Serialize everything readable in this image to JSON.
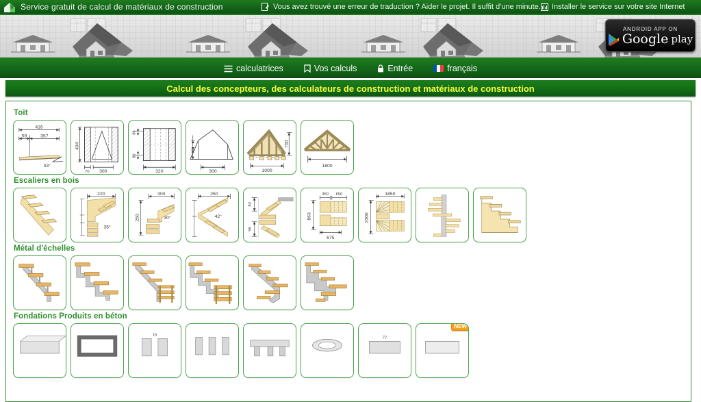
{
  "topbar": {
    "logo_icon": "house-leaf-logo-icon",
    "title": "Service gratuit de calcul de matériaux de construction",
    "links": [
      {
        "icon": "edit-note-icon",
        "label": "Vous avez trouvé une erreur de traduction ? Aider le projet. Il suffit d'une minute."
      },
      {
        "icon": "install-widget-icon",
        "label": "Installer le service sur votre site Internet"
      }
    ]
  },
  "banner": {
    "google_play": {
      "top_text": "ANDROID APP ON",
      "word1": "Google",
      "word2": "play",
      "icon": "google-play-triangle-icon"
    }
  },
  "nav": {
    "items": [
      {
        "icon": "hamburger-icon",
        "label": "calculatrices"
      },
      {
        "icon": "bookmark-icon",
        "label": "Vos calculs"
      },
      {
        "icon": "lock-icon",
        "label": "Entrée"
      },
      {
        "icon": "flag-france-icon",
        "label": "français"
      }
    ]
  },
  "page": {
    "title": "Calcul des concepteurs, des calculateurs de construction et matériaux de construction"
  },
  "sections": [
    {
      "title": "Toit",
      "tiles": [
        {
          "name": "roof-slope-calc",
          "labels": [
            "416",
            "59",
            "357",
            "33°"
          ]
        },
        {
          "name": "roof-gable-wall-calc",
          "labels": [
            "494",
            "70",
            "300"
          ]
        },
        {
          "name": "roof-wall-hatch-calc",
          "labels": [
            "86",
            "86",
            "320"
          ]
        },
        {
          "name": "roof-mansard-calc",
          "labels": [
            "300"
          ]
        },
        {
          "name": "roof-rafter-truss-calc",
          "labels": [
            "700",
            "1000"
          ]
        },
        {
          "name": "roof-truss-lattice-calc",
          "labels": [
            "1600"
          ]
        }
      ]
    },
    {
      "title": "Escaliers en bois",
      "tiles": [
        {
          "name": "wood-straight-stair-calc",
          "labels": []
        },
        {
          "name": "wood-stair-35deg-calc",
          "labels": [
            "220",
            "35°"
          ]
        },
        {
          "name": "wood-stair-30deg-calc",
          "labels": [
            "300",
            "250",
            "30°"
          ]
        },
        {
          "name": "wood-stair-zigzag-calc",
          "labels": [
            "250",
            "42°"
          ]
        },
        {
          "name": "wood-stair-landing-calc",
          "labels": [
            "83",
            "56"
          ]
        },
        {
          "name": "wood-stair-u-turn-calc",
          "labels": [
            "350",
            "650",
            "863",
            "675"
          ]
        },
        {
          "name": "wood-stair-winder-calc",
          "labels": [
            "1850",
            "2300"
          ]
        },
        {
          "name": "wood-spiral-stair-calc",
          "labels": []
        },
        {
          "name": "wood-stair-simple-calc",
          "labels": []
        }
      ]
    },
    {
      "title": "Métal d'échelles",
      "tiles": [
        {
          "name": "metal-stair-stringer-calc",
          "labels": []
        },
        {
          "name": "metal-stair-zigzag-calc",
          "labels": []
        },
        {
          "name": "metal-stair-with-ladder-calc",
          "labels": []
        },
        {
          "name": "metal-stair-platform-calc",
          "labels": []
        },
        {
          "name": "metal-stair-turn-calc",
          "labels": []
        },
        {
          "name": "metal-stair-landing-calc",
          "labels": []
        }
      ]
    },
    {
      "title": "Fondations Produits en béton",
      "tiles": [
        {
          "name": "foundation-slab-calc",
          "labels": []
        },
        {
          "name": "foundation-strip-calc",
          "labels": []
        },
        {
          "name": "foundation-column-calc",
          "labels": [
            "15"
          ]
        },
        {
          "name": "foundation-pile-calc",
          "labels": []
        },
        {
          "name": "foundation-grillage-calc",
          "labels": []
        },
        {
          "name": "foundation-ring-calc",
          "labels": []
        },
        {
          "name": "foundation-block-calc",
          "labels": [
            "77"
          ]
        },
        {
          "name": "foundation-new-calc",
          "labels": [],
          "badge": "NEW"
        }
      ]
    }
  ]
}
